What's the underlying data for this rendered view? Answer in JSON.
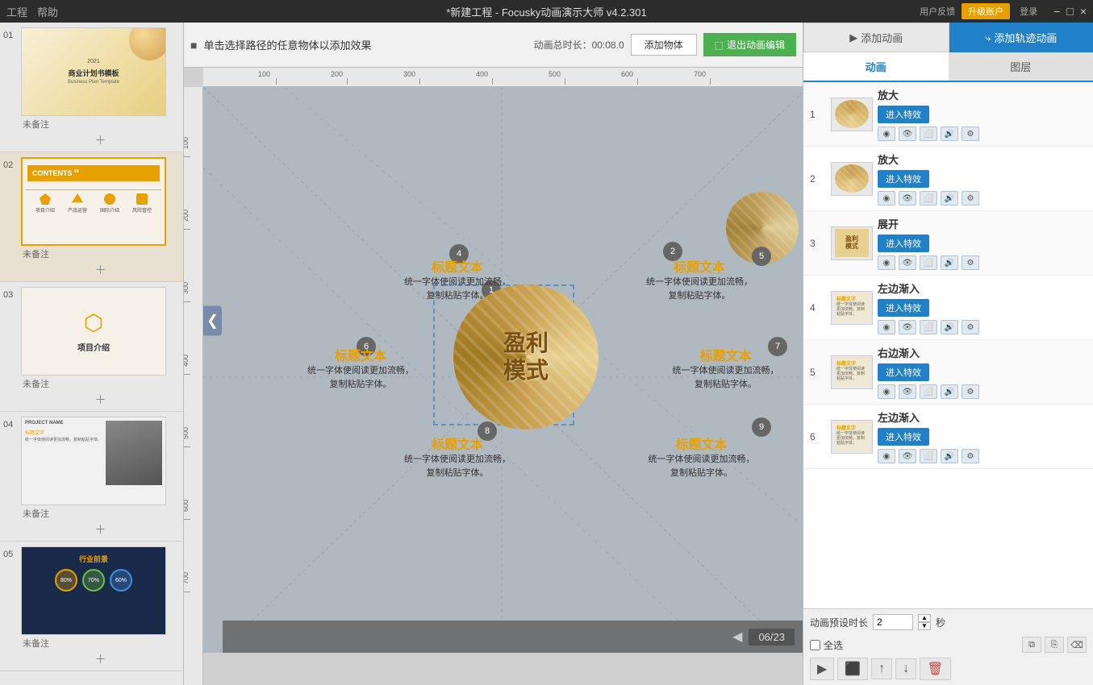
{
  "app": {
    "title": "*新建工程 - Focusky动画演示大师 v4.2.301",
    "menu_items": [
      "工程",
      "帮助"
    ]
  },
  "titlebar": {
    "user_feedback": "用户反馈",
    "upgrade_btn": "升级账户",
    "login_btn": "登录",
    "minimize": "−",
    "maximize": "□",
    "close": "×"
  },
  "toolbar": {
    "icon": "■",
    "instruction": "单击选择路径的任意物体以添加效果",
    "duration_label": "动画总时长：00:08.0",
    "add_object_btn": "添加物体",
    "exit_btn": "退出动画编辑"
  },
  "slides": [
    {
      "num": "01",
      "note": "未备注",
      "type": "business_plan"
    },
    {
      "num": "02",
      "note": "未备注",
      "type": "contents",
      "label": "CONTENTS",
      "nav_items": [
        "项目介绍",
        "产品运营",
        "国际介绍",
        "风险管控"
      ]
    },
    {
      "num": "03",
      "note": "未备注",
      "type": "project",
      "label": "项目介绍"
    },
    {
      "num": "04",
      "note": "未备注",
      "type": "building"
    },
    {
      "num": "05",
      "note": "未备注",
      "type": "industry",
      "label": "行业前景",
      "circles": [
        "80%",
        "70%",
        "60%"
      ]
    }
  ],
  "canvas": {
    "central_text_line1": "盈利",
    "central_text_line2": "模式",
    "text_blocks": [
      {
        "pos": "top_left",
        "title": "标题文本",
        "body": "统一字体使阅读更加流畅，\n复制粘贴字体。",
        "node": "4"
      },
      {
        "pos": "top_right",
        "title": "标题文本",
        "body": "统一字体使阅读更加流畅，\n复制粘贴字体。",
        "node": "2"
      },
      {
        "pos": "mid_left",
        "title": "标题文本",
        "body": "统一字体使阅读更加流畅，\n复制粘贴字体。",
        "node": "6"
      },
      {
        "pos": "mid_right",
        "title": "标题文本",
        "body": "统一字体使阅读更加流畅，\n复制粘贴字体。",
        "node": "7"
      },
      {
        "pos": "bot_left",
        "title": "标题文本",
        "body": "统一字体使阅读更加流畅，\n复制粘贴字体。",
        "node": "8"
      },
      {
        "pos": "bot_right",
        "title": "标题文本",
        "body": "统一字体使阅读更加流畅，\n复制粘贴字体。",
        "node": "9"
      }
    ],
    "page_indicator": "06/23"
  },
  "right_panel": {
    "add_anim_btn": "添加动画",
    "add_track_btn": "添加轨迹动画",
    "tab_anim": "动画",
    "tab_layer": "图层",
    "animations": [
      {
        "num": "1",
        "name": "放大",
        "effect": "进入特效"
      },
      {
        "num": "2",
        "name": "放大",
        "effect": "进入特效"
      },
      {
        "num": "3",
        "name": "展开",
        "effect": "进入特效"
      },
      {
        "num": "4",
        "name": "左边渐入",
        "effect": "进入特效"
      },
      {
        "num": "5",
        "name": "右边渐入",
        "effect": "进入特效"
      },
      {
        "num": "6",
        "name": "左边渐入",
        "effect": "进入特效"
      }
    ],
    "duration_label": "动画预设时长",
    "duration_value": "2",
    "duration_unit": "秒",
    "select_all": "全选",
    "bottom_actions": [
      "▶",
      "⬛",
      "↑",
      "↓",
      "🗑"
    ]
  },
  "ruler": {
    "h_marks": [
      100,
      200,
      300,
      400,
      500,
      600,
      700
    ],
    "v_marks": [
      100,
      200,
      300,
      400,
      500,
      600
    ]
  }
}
